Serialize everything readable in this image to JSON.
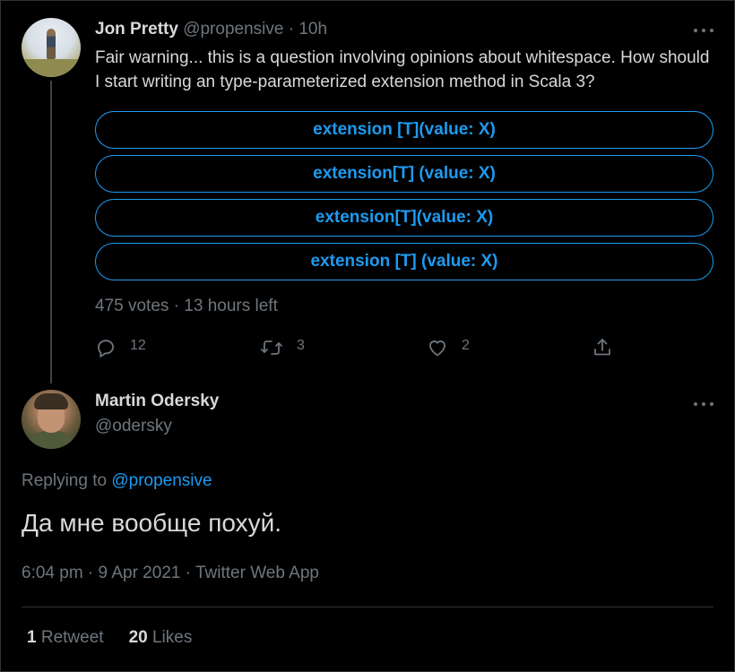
{
  "parent_tweet": {
    "author_name": "Jon Pretty",
    "handle": "@propensive",
    "separator": "·",
    "time": "10h",
    "text": "Fair warning... this is a question involving opinions about whitespace. How should I start writing an type-parameterized extension method in Scala 3?",
    "poll_options": [
      "extension [T](value: X)",
      "extension[T] (value: X)",
      "extension[T](value: X)",
      "extension [T] (value: X)"
    ],
    "poll_meta": "475 votes · 13 hours left",
    "actions": {
      "reply_icon": "reply-icon",
      "reply_count": "12",
      "retweet_icon": "retweet-icon",
      "retweet_count": "3",
      "like_icon": "heart-icon",
      "like_count": "2",
      "share_icon": "share-icon"
    }
  },
  "reply_tweet": {
    "author_name": "Martin Odersky",
    "handle": "@odersky",
    "replying_to_label": "Replying to",
    "replying_to_handle": "@propensive",
    "text": "Да мне вообще похуй.",
    "meta": "6:04 pm · 9 Apr 2021 · Twitter Web App",
    "stats": {
      "retweets_count": "1",
      "retweets_label": "Retweet",
      "likes_count": "20",
      "likes_label": "Likes"
    }
  },
  "colors": {
    "background": "#000000",
    "text": "#d9d9d9",
    "muted": "#6e767d",
    "accent": "#1d9bf0",
    "border": "#2f3336"
  }
}
